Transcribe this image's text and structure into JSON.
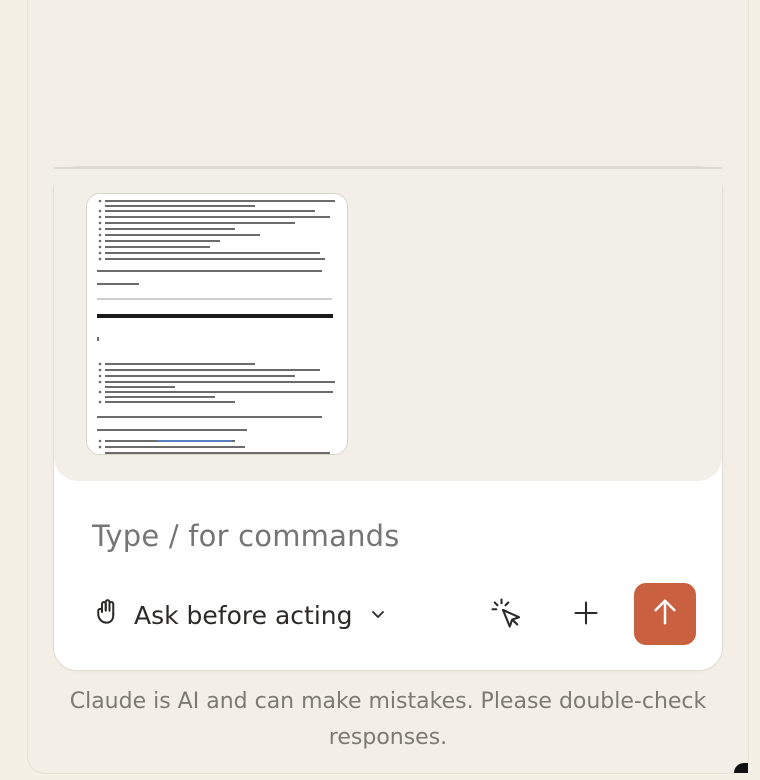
{
  "composer": {
    "placeholder": "Type / for commands",
    "mode_label": "Ask before acting",
    "send_color": "#c9603f"
  },
  "icons": {
    "mode": "hand-icon",
    "chevron": "chevron-down-icon",
    "select": "cursor-click-icon",
    "add": "plus-icon",
    "send": "arrow-up-icon"
  },
  "footer": {
    "disclaimer": "Claude is AI and can make mistakes. Please double-check responses."
  }
}
